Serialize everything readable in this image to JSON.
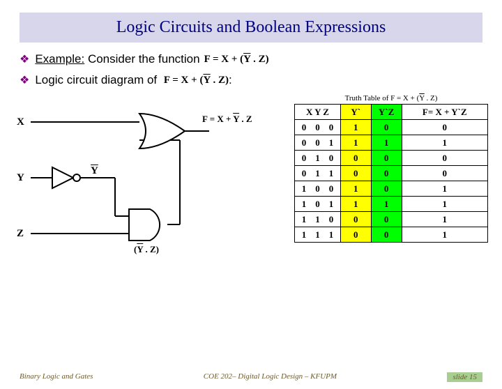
{
  "title": "Logic Circuits and Boolean Expressions",
  "bullet1": {
    "prefix": "Example:",
    "rest": " Consider the function"
  },
  "bullet2": {
    "text": "Logic circuit diagram of",
    "suffix": ":"
  },
  "formula_inline": "F = X + (Y . Z)",
  "circuit": {
    "X": "X",
    "Y": "Y",
    "Z": "Z",
    "Ybar": "Y",
    "and_out": "(Y . Z)",
    "out": "F = X + Y . Z"
  },
  "truth_table": {
    "caption": "Truth Table of F = X + (Y . Z)",
    "headers": {
      "xyz": "X  Y  Z",
      "ybar": "Y`",
      "ybarz": "Y`Z",
      "f": "F= X + Y`Z"
    },
    "rows": [
      {
        "xyz": "0  0  0",
        "ybar": "1",
        "ybarz": "0",
        "f": "0"
      },
      {
        "xyz": "0  0  1",
        "ybar": "1",
        "ybarz": "1",
        "f": "1"
      },
      {
        "xyz": "0  1  0",
        "ybar": "0",
        "ybarz": "0",
        "f": "0"
      },
      {
        "xyz": "0  1  1",
        "ybar": "0",
        "ybarz": "0",
        "f": "0"
      },
      {
        "xyz": "1  0  0",
        "ybar": "1",
        "ybarz": "0",
        "f": "1"
      },
      {
        "xyz": "1  0  1",
        "ybar": "1",
        "ybarz": "1",
        "f": "1"
      },
      {
        "xyz": "1  1  0",
        "ybar": "0",
        "ybarz": "0",
        "f": "1"
      },
      {
        "xyz": "1  1  1",
        "ybar": "0",
        "ybarz": "0",
        "f": "1"
      }
    ]
  },
  "footer": {
    "left": "Binary Logic and Gates",
    "center": "COE 202– Digital Logic Design – KFUPM",
    "right": "slide 15"
  }
}
